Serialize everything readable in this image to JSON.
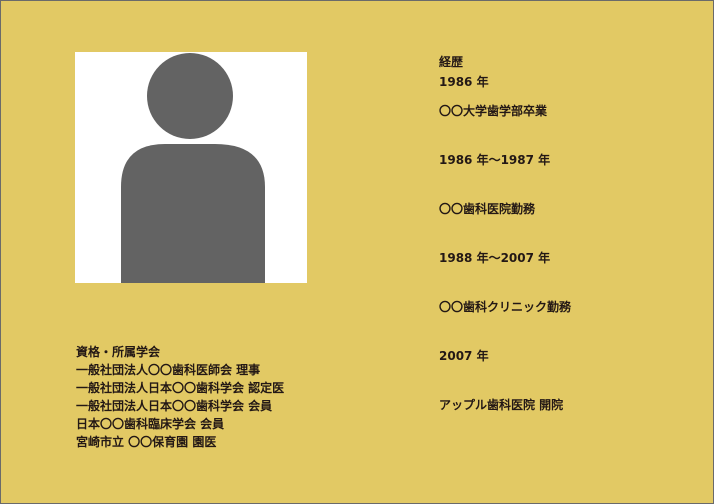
{
  "qualifications": {
    "heading": "資格・所属学会",
    "items": [
      "一般社団法人〇〇歯科医師会 理事",
      "一般社団法人日本〇〇歯科学会 認定医",
      "一般社団法人日本〇〇歯科学会 会員",
      "日本〇〇歯科臨床学会 会員",
      "宮崎市立 〇〇保育園 園医"
    ]
  },
  "career": {
    "heading": "経歴",
    "items": [
      "1986 年",
      "〇〇大学歯学部卒業",
      "1986 年〜1987 年",
      "〇〇歯科医院勤務",
      "1988 年〜2007 年",
      "〇〇歯科クリニック勤務",
      "2007 年",
      "アップル歯科医院 開院"
    ]
  },
  "colors": {
    "card_background": "#e2c964",
    "silhouette": "#636363",
    "text": "#231815"
  }
}
